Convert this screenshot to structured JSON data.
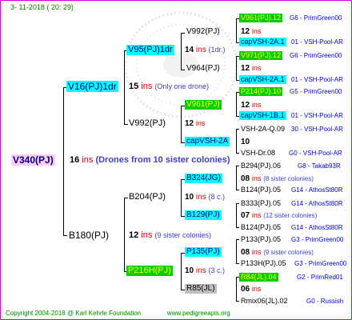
{
  "header": {
    "date": "3- 11-2018 ( 20: 29)"
  },
  "root": {
    "name": "V340(PJ)",
    "count": "16",
    "ins": "ins",
    "note": "(Drones from 10 sister colonies)"
  },
  "sire": {
    "name": "V16(PJ)1dr",
    "count": "15",
    "ins": "ins",
    "note": "(Only one drone)",
    "sire": {
      "name": "V95(PJ)1dr",
      "count": "14",
      "ins": "ins",
      "note": "(1dr.)",
      "sire": {
        "name": "V992(PJ)",
        "count": "12",
        "ins": "ins",
        "sire": {
          "name": "V961(PJ).12",
          "extra": "G6 - PrimGreen00"
        },
        "dam": {
          "name": "capVSH-2A.1",
          "extra": "01 - VSH-Pool-AR"
        }
      },
      "dam": {
        "name": "V964(PJ)",
        "count": "12",
        "ins": "ins",
        "sire": {
          "name": "V971(PJ).12",
          "extra": "G6 - PrimGreen00"
        },
        "dam": {
          "name": "capVSH-2A.1",
          "extra": "01 - VSH-Pool-AR"
        }
      }
    },
    "dam": {
      "name": "V992(PJ)",
      "count": "12",
      "ins": "ins",
      "sire": {
        "name": "V961(PJ)",
        "count": "12",
        "ins": "ins",
        "sire": {
          "name": "P214(PJ).10",
          "extra": "G5 - PrimGreen00"
        },
        "dam": {
          "name": "capVSH-1B.1",
          "extra": "01 - VSH-Pool-AR"
        }
      },
      "dam": {
        "name": "capVSH-2A",
        "count": "10",
        "sire": {
          "name": "VSH-2A-Q.09",
          "extra": "30 - VSH-Pool-AR"
        },
        "dam": {
          "name": "VSH-Dr.08",
          "extra": "G0 - VSH-Pool-AR"
        }
      }
    }
  },
  "dam": {
    "name": "B180(PJ)",
    "count": "12",
    "ins": "ins",
    "note": "(9 sister colonies)",
    "sire": {
      "name": "B204(PJ)",
      "count": "10",
      "ins": "ins",
      "note": "(8 c.)",
      "sire": {
        "name": "B324(JG)",
        "count": "08",
        "ins": "ins",
        "note": "(8 sister colonies)",
        "sire": {
          "name": "B294(PJ).06",
          "extra": "G8 - Takab93R"
        },
        "dam": {
          "name": "B124(PJ).05",
          "extra": "G14 - AthosSt80R"
        }
      },
      "dam": {
        "name": "B129(PJ)",
        "count": "07",
        "ins": "ins",
        "note": "(12 sister colonies)",
        "sire": {
          "name": "B333(PJ).05",
          "extra": "G14 - AthosSt80R"
        },
        "dam": {
          "name": "B124(PJ).05",
          "extra": "G14 - AthosSt80R"
        }
      }
    },
    "dam": {
      "name": "P216H(PJ)",
      "count": "10",
      "ins": "ins",
      "note": "(3 c.)",
      "sire": {
        "name": "P135(PJ)",
        "count": "08",
        "ins": "ins",
        "note": "(9 sister colonies)",
        "sire": {
          "name": "P133(PJ).05",
          "extra": "G3 - PrimGreen00"
        },
        "dam": {
          "name": "P133H(PJ).05",
          "extra": "G3 - PrimGreen00"
        }
      },
      "dam": {
        "name": "R85(JL)",
        "count": "06",
        "ins": "ins",
        "sire": {
          "name": "R84(JL).04",
          "extra": "G2 - PrimRed01"
        },
        "dam": {
          "name": "Rmix06(JL).02",
          "extra": "G0 - Russish"
        }
      }
    }
  },
  "footer": {
    "copyright": "Copyright 2004-2018 @ Karl Kehrle Foundation",
    "site": "www.pedigreeapis.org"
  },
  "colors": {
    "frame": "#cc00cc",
    "cyan": "#00ffff",
    "green": "#00cc00",
    "pink": "#ffccff",
    "ins": "#cc0000",
    "footer": "#008000"
  }
}
